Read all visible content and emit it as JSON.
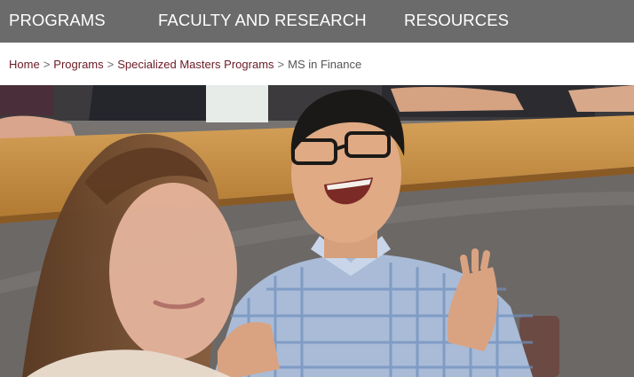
{
  "nav": {
    "items": [
      "PROGRAMS",
      "FACULTY AND RESEARCH",
      "RESOURCES"
    ]
  },
  "breadcrumb": {
    "items": [
      "Home",
      "Programs",
      "Specialized Masters Programs"
    ],
    "separator": ">",
    "current": "MS in Finance"
  },
  "hero": {
    "alt": "Students laughing in a lecture classroom"
  },
  "colors": {
    "nav_bg": "#6b6b6b",
    "nav_text": "#ffffff",
    "link": "#6b1a24",
    "breadcrumb_current": "#555555"
  }
}
